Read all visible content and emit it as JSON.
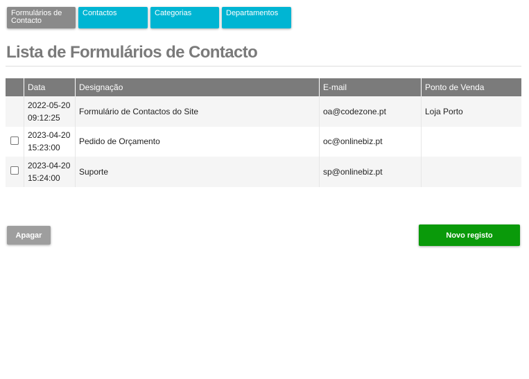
{
  "tabs": [
    {
      "label": "Formulários de Contacto",
      "active": true
    },
    {
      "label": "Contactos",
      "active": false
    },
    {
      "label": "Categorias",
      "active": false
    },
    {
      "label": "Departamentos",
      "active": false
    }
  ],
  "page_title": "Lista de Formulários de Contacto",
  "table": {
    "headers": [
      "",
      "Data",
      "Designação",
      "E-mail",
      "Ponto de Venda"
    ],
    "rows": [
      {
        "selectable": false,
        "date": "2022-05-20",
        "time": "09:12:25",
        "designation": "Formulário de Contactos do Site",
        "email": "oa@codezone.pt",
        "store": "Loja Porto"
      },
      {
        "selectable": true,
        "date": "2023-04-20",
        "time": "15:23:00",
        "designation": "Pedido de Orçamento",
        "email": "oc@onlinebiz.pt",
        "store": ""
      },
      {
        "selectable": true,
        "date": "2023-04-20",
        "time": "15:24:00",
        "designation": "Suporte",
        "email": "sp@onlinebiz.pt",
        "store": ""
      }
    ]
  },
  "buttons": {
    "delete_label": "Apagar",
    "new_label": "Novo registo"
  },
  "colors": {
    "tab_active": "#8a8a8a",
    "tab_inactive": "#00b5d3",
    "header_bg": "#7b7b7b",
    "delete_button": "#9e9e9e",
    "new_button": "#0a9a0a"
  }
}
